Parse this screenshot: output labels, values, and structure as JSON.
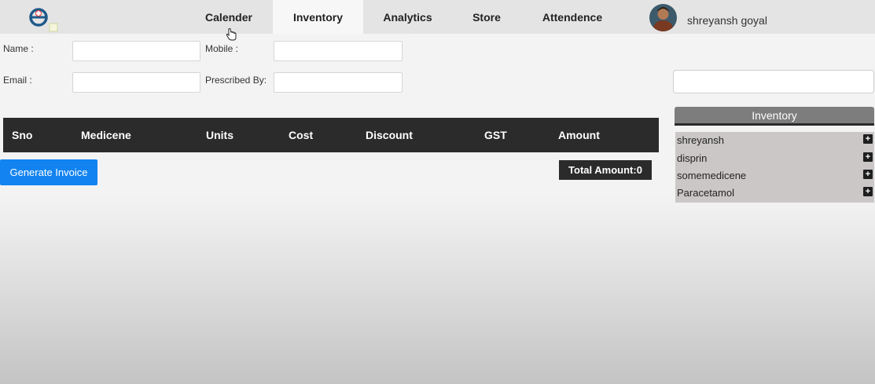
{
  "nav": {
    "tabs": [
      {
        "label": "Calender"
      },
      {
        "label": "Inventory"
      },
      {
        "label": "Analytics"
      },
      {
        "label": "Store"
      },
      {
        "label": "Attendence"
      }
    ],
    "active_tab": "Inventory",
    "user_name": "shreyansh goyal"
  },
  "form": {
    "name_label": "Name :",
    "mobile_label": "Mobile :",
    "email_label": "Email :",
    "prescribed_label": "Prescribed By:",
    "name_value": "",
    "mobile_value": "",
    "email_value": "",
    "prescribed_value": ""
  },
  "table": {
    "columns": [
      "Sno",
      "Medicene",
      "Units",
      "Cost",
      "Discount",
      "GST",
      "Amount"
    ],
    "rows": []
  },
  "actions": {
    "generate_label": "Generate Invoice",
    "total_label": "Total Amount:0"
  },
  "inventory": {
    "search_value": "",
    "header": "Inventory",
    "items": [
      "shreyansh",
      "disprin",
      "somemedicene",
      "Paracetamol"
    ]
  },
  "colors": {
    "accent_button": "#1283f0",
    "table_header": "#2b2b2b",
    "inventory_header": "#7d7d7d",
    "inventory_list": "#cbc7c7"
  }
}
